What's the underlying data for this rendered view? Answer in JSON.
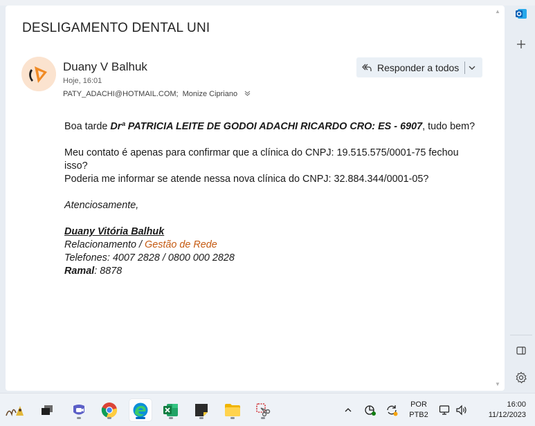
{
  "email": {
    "subject": "DESLIGAMENTO DENTAL UNI",
    "sender_name": "Duany V Balhuk",
    "date": "Hoje, 16:01",
    "recipient_1": "PATY_ADACHI@HOTMAIL.COM;",
    "recipient_2": "Monize Cipriano",
    "reply_all_label": "Responder a todos",
    "body": {
      "greeting_prefix": "Boa tarde ",
      "greeting_name": "Drª PATRICIA LEITE DE GODOI ADACHI RICARDO CRO: ES - 6907",
      "greeting_suffix": ", tudo bem?",
      "line1": "Meu contato é apenas para confirmar que a clínica do CNPJ: 19.515.575/0001-75 fechou isso?",
      "line2": "Poderia me informar se atende nessa nova clínica do CNPJ: 32.884.344/0001-05?",
      "closing": "Atenciosamente,",
      "sig_name": "Duany Vitória Balhuk ",
      "sig_role_prefix": "Relacionamento / ",
      "sig_role_dept": "Gestão de Rede",
      "sig_phones": "Telefones: 4007 2828 / 0800 000 2828",
      "sig_ramal_label": "Ramal",
      "sig_ramal_value": ": 8878"
    }
  },
  "rail": {
    "icons": [
      "outlook-icon",
      "add-icon",
      "reading-pane-icon",
      "settings-icon"
    ]
  },
  "taskbar": {
    "apps": [
      "widget-icon",
      "task-view-icon",
      "teams-icon",
      "chrome-icon",
      "edge-icon",
      "excel-icon",
      "sticky-notes-icon",
      "file-explorer-icon",
      "snipping-tool-icon"
    ],
    "lang_line1": "POR",
    "lang_line2": "PTB2",
    "time": "16:00",
    "date": "11/12/2023"
  },
  "colors": {
    "accent": "#0067c0",
    "signature_orange": "#c55a11",
    "reply_bg": "#eaf0f6"
  }
}
